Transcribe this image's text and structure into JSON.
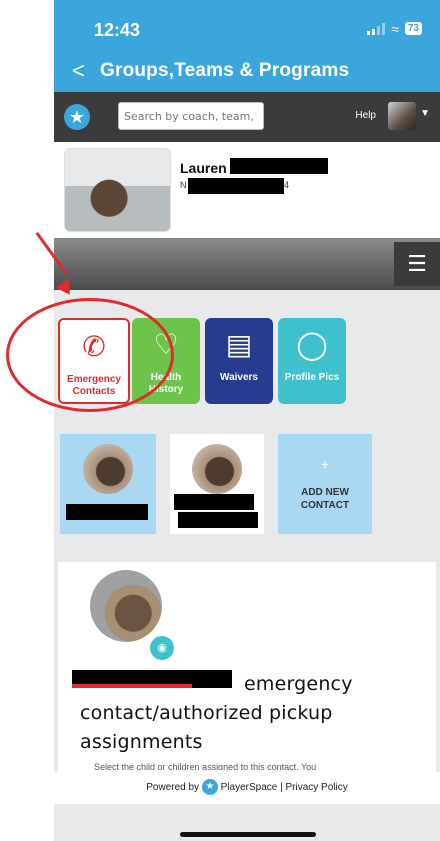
{
  "status_bar": {
    "time": "12:43",
    "battery": "73"
  },
  "nav": {
    "back_symbol": "<",
    "title": "Groups,Teams & Programs"
  },
  "app_header": {
    "search_placeholder": "Search by coach, team, p",
    "help_label": "Help"
  },
  "profile": {
    "name": "Lauren",
    "subtitle_prefix": "N",
    "subtitle_suffix": "4"
  },
  "menu": {
    "icon": "hamburger-icon"
  },
  "tiles": [
    {
      "label": "Emergency Contacts",
      "icon": "phone-plus-icon",
      "color": "#e12b2b"
    },
    {
      "label": "Health History",
      "icon": "heart-pulse-icon",
      "color": "#6ec34b"
    },
    {
      "label": "Waivers",
      "icon": "document-alert-icon",
      "color": "#283c8f"
    },
    {
      "label": "Profile Pics",
      "icon": "camera-icon",
      "color": "#3ec1cd"
    }
  ],
  "contacts": {
    "add_plus": "+",
    "add_label": "ADD NEW CONTACT"
  },
  "detail": {
    "title": "emergency contact/authorized pickup assignments",
    "note": "Select the child or children assigned to this contact. You"
  },
  "footer": {
    "powered_by": "Powered by",
    "brand": "PlayerSpace",
    "separator": "|",
    "privacy": "Privacy Policy"
  },
  "colors": {
    "nav_blue": "#3aa6dc",
    "annotation_red": "#e12b2b"
  }
}
